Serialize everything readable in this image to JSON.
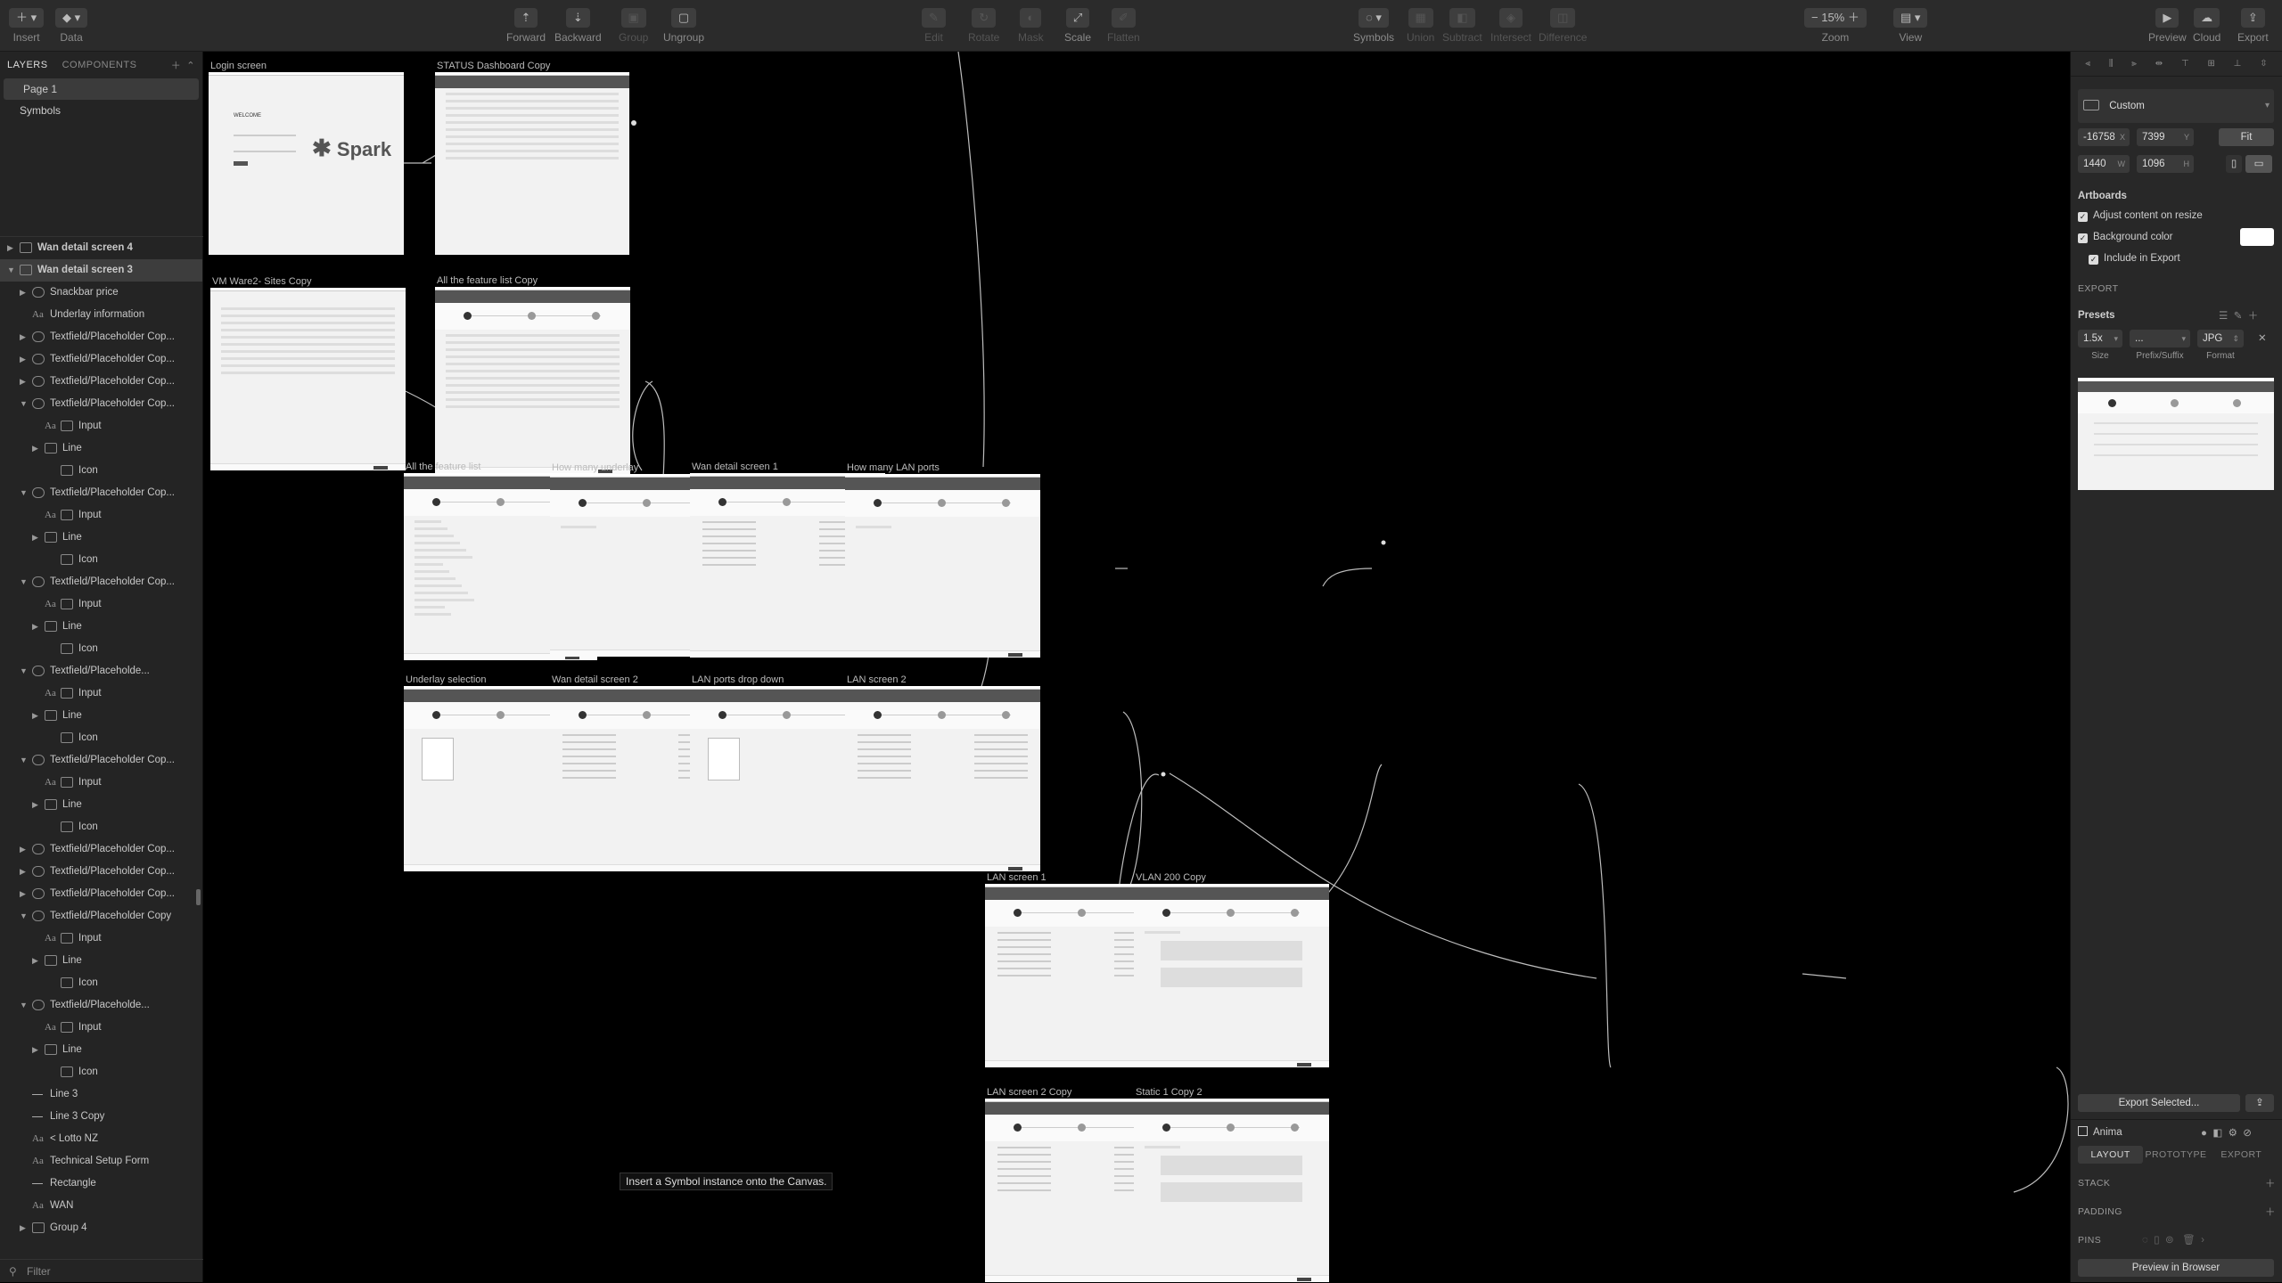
{
  "toolbar": {
    "insert": "Insert",
    "data": "Data",
    "forward": "Forward",
    "backward": "Backward",
    "group": "Group",
    "ungroup": "Ungroup",
    "edit": "Edit",
    "rotate": "Rotate",
    "mask": "Mask",
    "scale": "Scale",
    "flatten": "Flatten",
    "symbols": "Symbols",
    "union": "Union",
    "subtract": "Subtract",
    "intersect": "Intersect",
    "difference": "Difference",
    "zoom_value": "15%",
    "zoom": "Zoom",
    "view": "View",
    "preview": "Preview",
    "cloud": "Cloud",
    "export": "Export"
  },
  "left": {
    "tab_layers": "LAYERS",
    "tab_components": "COMPONENTS",
    "pages": [
      "Page 1",
      "Symbols"
    ],
    "layers": [
      "Wan detail screen 4",
      "Wan detail screen 3",
      "Snackbar price",
      "Underlay information",
      "Textfield/Placeholder Cop...",
      "Textfield/Placeholder Cop...",
      "Textfield/Placeholder Cop...",
      "Textfield/Placeholder Cop...",
      "Input",
      "Line",
      "Icon",
      "Textfield/Placeholder Cop...",
      "Input",
      "Line",
      "Icon",
      "Textfield/Placeholder Cop...",
      "Input",
      "Line",
      "Icon",
      "Textfield/Placeholde...",
      "Input",
      "Line",
      "Icon",
      "Textfield/Placeholder Cop...",
      "Input",
      "Line",
      "Icon",
      "Textfield/Placeholder Cop...",
      "Textfield/Placeholder Cop...",
      "Textfield/Placeholder Cop...",
      "Textfield/Placeholder Copy",
      "Input",
      "Line",
      "Icon",
      "Textfield/Placeholde...",
      "Input",
      "Line",
      "Icon",
      "Line 3",
      "Line 3 Copy",
      "< Lotto NZ",
      "Technical Setup Form",
      "Rectangle",
      "WAN",
      "Group 4"
    ],
    "filter": "Filter"
  },
  "canvas": {
    "artboards": [
      "Login screen",
      "STATUS Dashboard Copy",
      "VM Ware2- Sites Copy",
      "All the feature list Copy",
      "All the feature list",
      "How many underlay",
      "Wan detail screen 1",
      "How many LAN ports",
      "Underlay selection",
      "Wan detail screen 2",
      "LAN ports drop down",
      "LAN screen 2",
      "LAN screen 1",
      "VLAN 200 Copy",
      "LAN screen 2 Copy",
      "Static 1 Copy 2"
    ],
    "login_logo": "Spark",
    "login_welcome": "WELCOME",
    "hint": "Insert a Symbol instance onto the Canvas."
  },
  "inspector": {
    "preset": "Custom",
    "x": "-16758",
    "x_label": "X",
    "y": "7399",
    "y_label": "Y",
    "w": "1440",
    "w_label": "W",
    "h": "1096",
    "h_label": "H",
    "fit": "Fit",
    "artboards_title": "Artboards",
    "adjust": "Adjust content on resize",
    "bg_color": "Background color",
    "include_export": "Include in Export",
    "export_title": "EXPORT",
    "presets": "Presets",
    "size": "1.5x",
    "prefix": "...",
    "format": "JPG",
    "size_label": "Size",
    "prefix_label": "Prefix/Suffix",
    "format_label": "Format",
    "export_selected": "Export Selected...",
    "plugin": "Anima",
    "tab_layout": "LAYOUT",
    "tab_prototype": "PROTOTYPE",
    "tab_export": "EXPORT",
    "stack": "STACK",
    "padding": "PADDING",
    "pins": "PINS",
    "preview_browser": "Preview in Browser"
  }
}
